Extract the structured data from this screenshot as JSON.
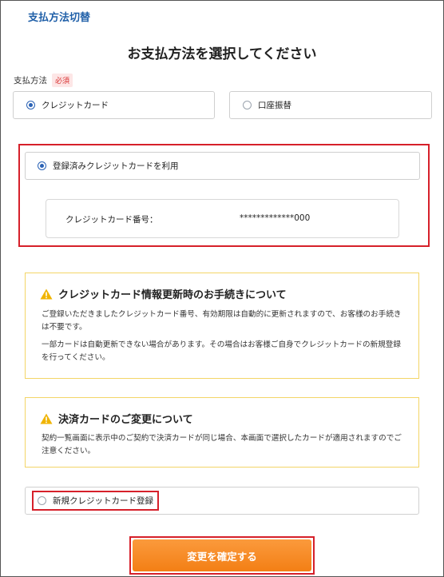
{
  "header": {
    "breadcrumb": "支払方法切替"
  },
  "main": {
    "title": "お支払方法を選択してください",
    "payment_method_label": "支払方法",
    "required_badge": "必須",
    "options": {
      "credit": "クレジットカード",
      "bank": "口座振替"
    },
    "registered_card_option": "登録済みクレジットカードを利用",
    "card": {
      "label": "クレジットカード番号：",
      "number": "*************000"
    },
    "notice1": {
      "title": "クレジットカード情報更新時のお手続きについて",
      "p1": "ご登録いただきましたクレジットカード番号、有効期限は自動的に更新されますので、お客様のお手続きは不要です。",
      "p2": "一部カードは自動更新できない場合があります。その場合はお客様ご自身でクレジットカードの新規登録を行ってください。"
    },
    "notice2": {
      "title": "決済カードのご変更について",
      "p1": "契約一覧画面に表示中のご契約で決済カードが同じ場合、本画面で選択したカードが適用されますのでご注意ください。"
    },
    "new_card_option": "新規クレジットカード登録",
    "confirm_button": "変更を確定する"
  },
  "colors": {
    "accent_blue": "#2a62b5",
    "highlight_red": "#d6202a",
    "button_orange": "#f58a22",
    "notice_border": "#f3d567",
    "warning_yellow": "#f0b400"
  }
}
